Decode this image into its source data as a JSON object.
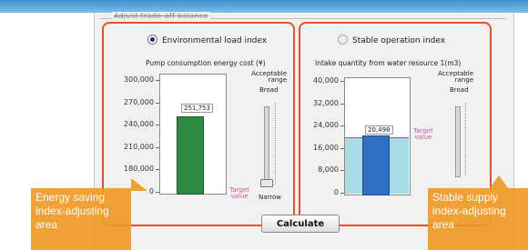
{
  "group_title": "Adjust trade-off balance",
  "left_panel": {
    "radio_label": "Environmental load index",
    "radio_selected": true,
    "caption": "Pump consumption energy cost (¥)",
    "y_ticks": [
      "300,000",
      "270,000",
      "240,000",
      "210,000",
      "180,000",
      "0"
    ],
    "value_label": "251,753",
    "acceptable_label": "Acceptable range",
    "broad_label": "Broad",
    "narrow_label": "Narrow",
    "target_label": "Target value"
  },
  "right_panel": {
    "radio_label": "Stable operation index",
    "radio_selected": false,
    "caption": "Intake quantity from water resource 1(m3)",
    "y_ticks": [
      "40,000",
      "32,000",
      "24,000",
      "16,000",
      "8,000",
      "0"
    ],
    "value_label": "20,498",
    "acceptable_label": "Acceptable range",
    "broad_label": "Broad",
    "target_label": "Target value"
  },
  "calculate_button": "Calculate",
  "callouts": {
    "left": "Energy saving index-adjusting area",
    "right": "Stable supply index-adjusting area"
  },
  "colors": {
    "panel_border": "#e8502e",
    "callout_bg": "#ef9926",
    "bar_green": "#2e8a3e",
    "bar_blue": "#2f6fc4",
    "band_cyan": "#a6dde6",
    "target_magenta": "#d33a8f"
  },
  "chart_data": [
    {
      "type": "bar",
      "title": "Pump consumption energy cost (¥)",
      "categories": [
        ""
      ],
      "values": [
        251753
      ],
      "y_ticks": [
        0,
        180000,
        210000,
        240000,
        270000,
        300000
      ]
    },
    {
      "type": "bar",
      "title": "Intake quantity from water resource 1(m3)",
      "categories": [
        ""
      ],
      "values": [
        20498
      ],
      "ylim": [
        0,
        40000
      ],
      "y_ticks": [
        0,
        8000,
        16000,
        24000,
        32000,
        40000
      ]
    }
  ]
}
